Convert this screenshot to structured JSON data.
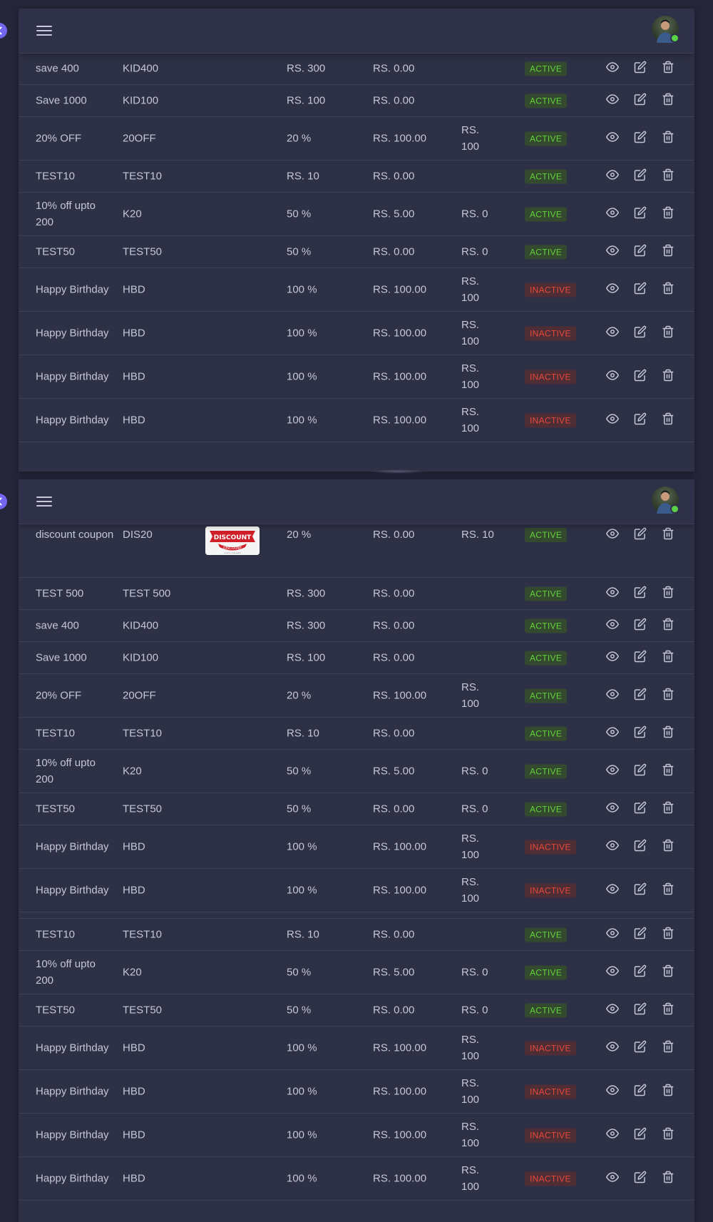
{
  "icons": {
    "menu": "hamburger-menu-icon",
    "view": "eye-icon",
    "edit": "edit-icon",
    "delete": "trash-icon",
    "toggle": "chevron-left-icon",
    "avatar": "user-avatar"
  },
  "colors": {
    "background": "#25263a",
    "panel": "#2e3046",
    "accent": "#7367f0",
    "active_text": "#62d33a",
    "inactive_text": "#e8493b",
    "online_dot": "#5ad246"
  },
  "coupon_image": {
    "line1": "DISCOUNT",
    "line2": "DISCOUNT",
    "caption": "coupon code apply"
  },
  "panel1": {
    "rows": [
      {
        "name": "save 400",
        "code": "KID400",
        "discount": "RS. 300",
        "min": "RS. 0.00",
        "max": "",
        "status": "ACTIVE",
        "h": 45
      },
      {
        "name": "Save 1000",
        "code": "KID100",
        "discount": "RS. 100",
        "min": "RS. 0.00",
        "max": "",
        "status": "ACTIVE",
        "h": 45
      },
      {
        "name": "20% OFF",
        "code": "20OFF",
        "discount": "20 %",
        "min": "RS. 100.00",
        "max": "RS. 100",
        "status": "ACTIVE",
        "h": 61
      },
      {
        "name": "TEST10",
        "code": "TEST10",
        "discount": "RS. 10",
        "min": "RS. 0.00",
        "max": "",
        "status": "ACTIVE",
        "h": 45
      },
      {
        "name": "10% off upto 200",
        "code": "K20",
        "discount": "50 %",
        "min": "RS. 5.00",
        "max": "RS. 0",
        "status": "ACTIVE",
        "h": 61
      },
      {
        "name": "TEST50",
        "code": "TEST50",
        "discount": "50 %",
        "min": "RS. 0.00",
        "max": "RS. 0",
        "status": "ACTIVE",
        "h": 45
      },
      {
        "name": "Happy Birthday",
        "code": "HBD",
        "discount": "100 %",
        "min": "RS. 100.00",
        "max": "RS. 100",
        "status": "INACTIVE",
        "h": 61
      },
      {
        "name": "Happy Birthday",
        "code": "HBD",
        "discount": "100 %",
        "min": "RS. 100.00",
        "max": "RS. 100",
        "status": "INACTIVE",
        "h": 61
      },
      {
        "name": "Happy Birthday",
        "code": "HBD",
        "discount": "100 %",
        "min": "RS. 100.00",
        "max": "RS. 100",
        "status": "INACTIVE",
        "h": 61
      },
      {
        "name": "Happy Birthday",
        "code": "HBD",
        "discount": "100 %",
        "min": "RS. 100.00",
        "max": "RS. 100",
        "status": "INACTIVE",
        "h": 61
      }
    ]
  },
  "panel2": {
    "rows": [
      {
        "name": "discount coupon",
        "code": "DIS20",
        "discount": "20 %",
        "min": "RS. 0.00",
        "max": "RS. 10",
        "status": "ACTIVE",
        "h": 76,
        "image": true,
        "top": true
      },
      {
        "name": "TEST 500",
        "code": "TEST 500",
        "discount": "RS. 300",
        "min": "RS. 0.00",
        "max": "",
        "status": "ACTIVE",
        "h": 45
      },
      {
        "name": "save 400",
        "code": "KID400",
        "discount": "RS. 300",
        "min": "RS. 0.00",
        "max": "",
        "status": "ACTIVE",
        "h": 45
      },
      {
        "name": "Save 1000",
        "code": "KID100",
        "discount": "RS. 100",
        "min": "RS. 0.00",
        "max": "",
        "status": "ACTIVE",
        "h": 45
      },
      {
        "name": "20% OFF",
        "code": "20OFF",
        "discount": "20 %",
        "min": "RS. 100.00",
        "max": "RS. 100",
        "status": "ACTIVE",
        "h": 61
      },
      {
        "name": "TEST10",
        "code": "TEST10",
        "discount": "RS. 10",
        "min": "RS. 0.00",
        "max": "",
        "status": "ACTIVE",
        "h": 45
      },
      {
        "name": "10% off upto 200",
        "code": "K20",
        "discount": "50 %",
        "min": "RS. 5.00",
        "max": "RS. 0",
        "status": "ACTIVE",
        "h": 61
      },
      {
        "name": "TEST50",
        "code": "TEST50",
        "discount": "50 %",
        "min": "RS. 0.00",
        "max": "RS. 0",
        "status": "ACTIVE",
        "h": 45
      },
      {
        "name": "Happy Birthday",
        "code": "HBD",
        "discount": "100 %",
        "min": "RS. 100.00",
        "max": "RS. 100",
        "status": "INACTIVE",
        "h": 61
      },
      {
        "name": "Happy Birthday",
        "code": "HBD",
        "discount": "100 %",
        "min": "RS. 100.00",
        "max": "RS. 100",
        "status": "INACTIVE",
        "h": 61
      },
      {
        "name": "",
        "code": "",
        "discount": "",
        "min": "",
        "max": "",
        "status": "",
        "h": 9,
        "spacer": true
      },
      {
        "name": "TEST10",
        "code": "TEST10",
        "discount": "RS. 10",
        "min": "RS. 0.00",
        "max": "",
        "status": "ACTIVE",
        "h": 45
      },
      {
        "name": "10% off upto 200",
        "code": "K20",
        "discount": "50 %",
        "min": "RS. 5.00",
        "max": "RS. 0",
        "status": "ACTIVE",
        "h": 61
      },
      {
        "name": "TEST50",
        "code": "TEST50",
        "discount": "50 %",
        "min": "RS. 0.00",
        "max": "RS. 0",
        "status": "ACTIVE",
        "h": 45
      },
      {
        "name": "Happy Birthday",
        "code": "HBD",
        "discount": "100 %",
        "min": "RS. 100.00",
        "max": "RS. 100",
        "status": "INACTIVE",
        "h": 61
      },
      {
        "name": "Happy Birthday",
        "code": "HBD",
        "discount": "100 %",
        "min": "RS. 100.00",
        "max": "RS. 100",
        "status": "INACTIVE",
        "h": 61
      },
      {
        "name": "Happy Birthday",
        "code": "HBD",
        "discount": "100 %",
        "min": "RS. 100.00",
        "max": "RS. 100",
        "status": "INACTIVE",
        "h": 61
      },
      {
        "name": "Happy Birthday",
        "code": "HBD",
        "discount": "100 %",
        "min": "RS. 100.00",
        "max": "RS. 100",
        "status": "INACTIVE",
        "h": 61
      }
    ]
  }
}
